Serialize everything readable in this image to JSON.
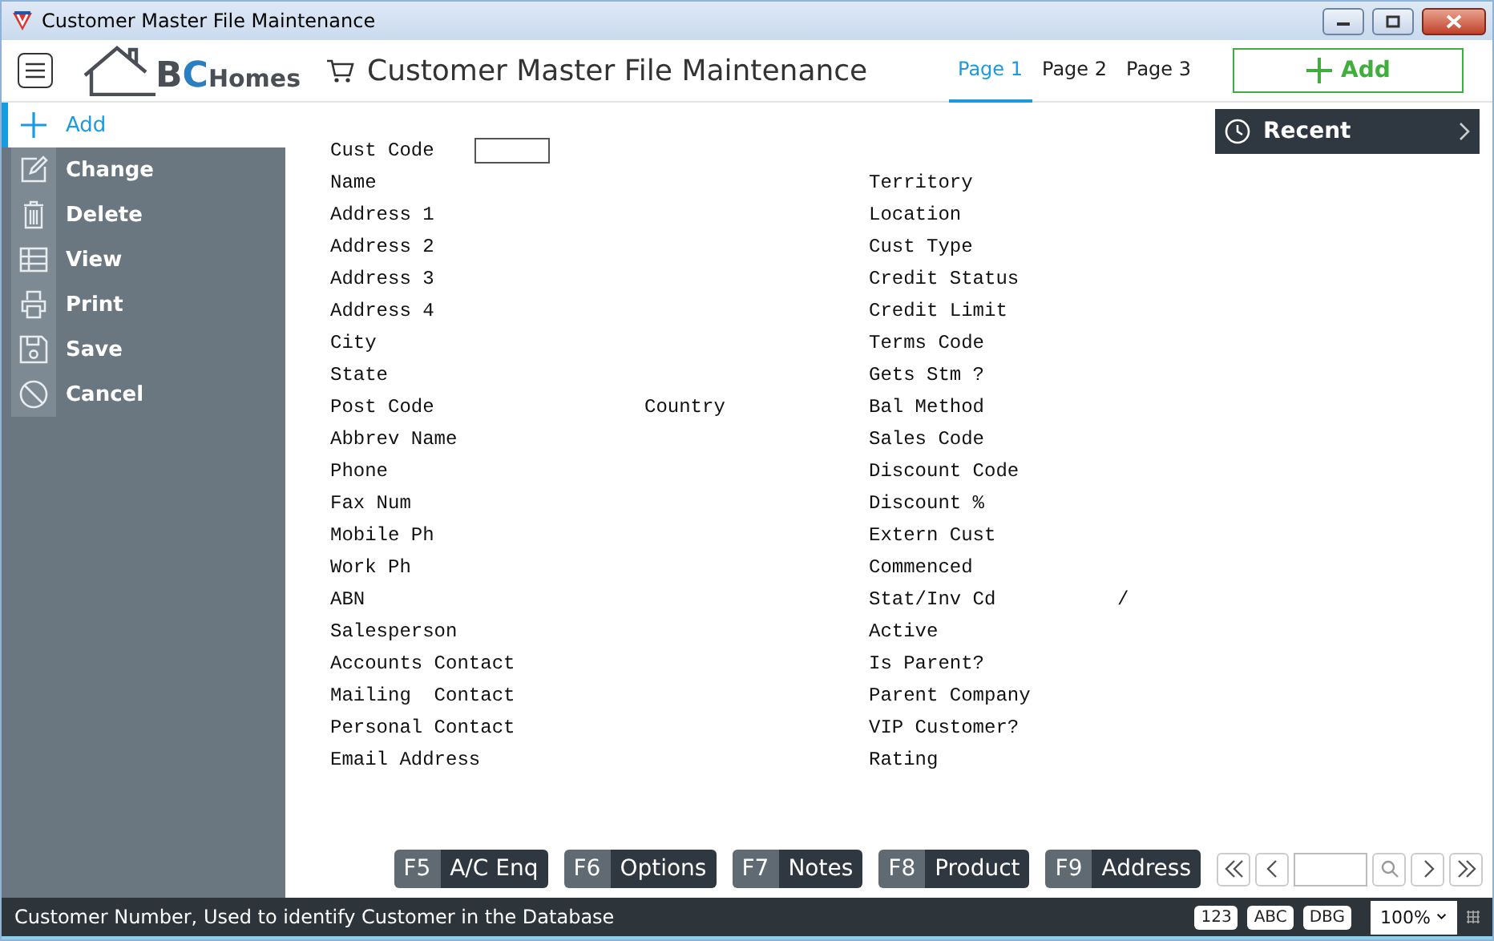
{
  "window": {
    "title": "Customer Master File Maintenance"
  },
  "header": {
    "logo": [
      {
        "text": "B",
        "color": "#4a4f55"
      },
      {
        "text": "C",
        "color": "#2a7fc1"
      },
      {
        "text": "Homes",
        "color": "#4a4f55"
      }
    ],
    "title": "Customer Master File Maintenance",
    "pages": [
      {
        "label": "Page 1",
        "selected": true
      },
      {
        "label": "Page 2",
        "selected": false
      },
      {
        "label": "Page 3",
        "selected": false
      }
    ],
    "add_button": "Add"
  },
  "sidebar": {
    "items": [
      {
        "label": "Add",
        "kind": "plus",
        "selected": true
      },
      {
        "label": "Change",
        "kind": "edit",
        "selected": false
      },
      {
        "label": "Delete",
        "kind": "trash",
        "selected": false
      },
      {
        "label": "View",
        "kind": "table",
        "selected": false
      },
      {
        "label": "Print",
        "kind": "printer",
        "selected": false
      },
      {
        "label": "Save",
        "kind": "save",
        "selected": false
      },
      {
        "label": "Cancel",
        "kind": "cancel",
        "selected": false
      }
    ]
  },
  "form": {
    "cust_code": "Cust Code",
    "left": [
      {
        "label": "Name"
      },
      {
        "label": "Address 1"
      },
      {
        "label": "Address 2"
      },
      {
        "label": "Address 3"
      },
      {
        "label": "Address 4"
      },
      {
        "label": "City"
      },
      {
        "label": "State"
      },
      {
        "label": "Post Code",
        "extra": "Country"
      },
      {
        "label": "Abbrev Name"
      },
      {
        "label": "Phone"
      },
      {
        "label": "Fax Num"
      },
      {
        "label": "Mobile Ph"
      },
      {
        "label": "Work Ph"
      },
      {
        "label": "ABN"
      },
      {
        "label": "Salesperson"
      },
      {
        "label": "Accounts Contact"
      },
      {
        "label": "Mailing  Contact"
      },
      {
        "label": "Personal Contact"
      },
      {
        "label": "Email Address"
      }
    ],
    "right": [
      {
        "label": "Territory"
      },
      {
        "label": "Location"
      },
      {
        "label": "Cust Type"
      },
      {
        "label": "Credit Status"
      },
      {
        "label": "Credit Limit"
      },
      {
        "label": "Terms Code"
      },
      {
        "label": "Gets Stm ?"
      },
      {
        "label": "Bal Method"
      },
      {
        "label": "Sales Code"
      },
      {
        "label": "Discount Code"
      },
      {
        "label": "Discount %"
      },
      {
        "label": "Extern Cust"
      },
      {
        "label": "Commenced"
      },
      {
        "label": "Stat/Inv Cd",
        "extra": "/"
      },
      {
        "label": "Active"
      },
      {
        "label": "Is Parent?"
      },
      {
        "label": "Parent Company"
      },
      {
        "label": "VIP Customer?"
      },
      {
        "label": "Rating"
      }
    ]
  },
  "recent": {
    "title": "Recent"
  },
  "function_keys": [
    {
      "key": "F5",
      "label": "A/C Enq"
    },
    {
      "key": "F6",
      "label": "Options"
    },
    {
      "key": "F7",
      "label": "Notes"
    },
    {
      "key": "F8",
      "label": "Product"
    },
    {
      "key": "F9",
      "label": "Address"
    }
  ],
  "status_bar": {
    "message": "Customer Number, Used to identify Customer in the Database",
    "toggles": [
      "123",
      "ABC",
      "DBG"
    ],
    "zoom": "100%"
  }
}
